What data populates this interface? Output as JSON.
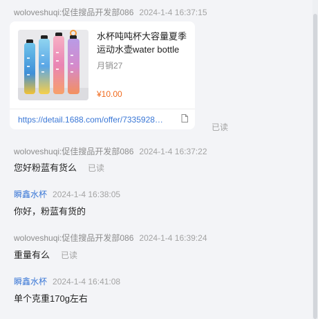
{
  "messages": [
    {
      "sender": "woloveshuqi:促佳搜品开发部086",
      "time": "2024-1-4 16:37:15"
    },
    {
      "sender": "woloveshuqi:促佳搜品开发部086",
      "time": "2024-1-4 16:37:22",
      "text": "您好粉蓝有货么",
      "status": "已读"
    },
    {
      "sender": "瞬鑫水杯",
      "time": "2024-1-4 16:38:05",
      "text": "你好，粉蓝有货的"
    },
    {
      "sender": "woloveshuqi:促佳搜品开发部086",
      "time": "2024-1-4 16:39:24",
      "text": "重量有么",
      "status": "已读"
    },
    {
      "sender": "瞬鑫水杯",
      "time": "2024-1-4 16:41:08",
      "text": "单个克重170g左右"
    }
  ],
  "product_card": {
    "title": "水杯吨吨杯大容量夏季运动水壶water bottle",
    "sales": "月销27",
    "price": "¥10.00",
    "link": "https://detail.1688.com/offer/733592851244.html",
    "status": "已读"
  },
  "colors": {
    "self_sender": "#3a77d6",
    "price": "#f06a1d",
    "link": "#3a77d6"
  }
}
